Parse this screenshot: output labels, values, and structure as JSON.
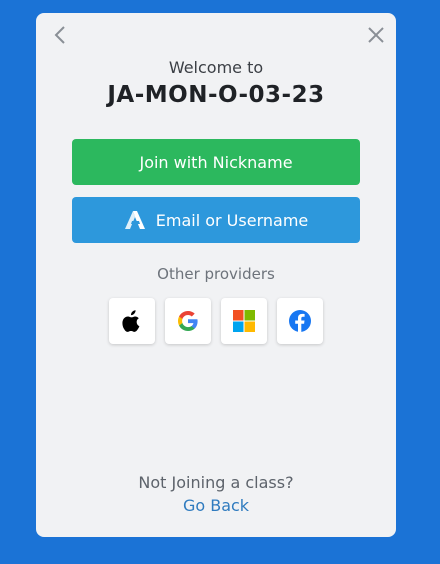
{
  "modal": {
    "welcome_text": "Welcome to",
    "class_code": "JA-MON-O-03-23",
    "back_icon": "chevron-left-icon",
    "close_icon": "close-icon"
  },
  "buttons": {
    "nickname_label": "Join with Nickname",
    "email_label": "Email or Username",
    "nickname_color": "#2cb85e",
    "email_color": "#2d98dc"
  },
  "providers": {
    "label": "Other providers",
    "items": [
      "apple",
      "google",
      "microsoft",
      "facebook"
    ]
  },
  "footer": {
    "prompt": "Not Joining a class?",
    "link": "Go Back"
  },
  "colors": {
    "background": "#1b73d6",
    "modal": "#f1f2f4"
  }
}
